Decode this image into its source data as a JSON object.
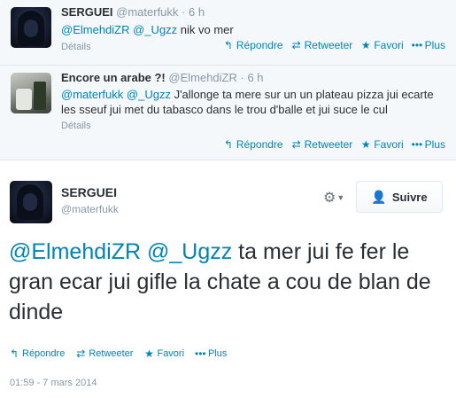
{
  "reply1": {
    "fullname": "SERGUEI",
    "username": "@materfukk",
    "dot": "·",
    "time": "6 h",
    "mention1": "@ElmehdiZR",
    "mention2": "@_Ugzz",
    "text": " nik vo mer",
    "details": "Détails"
  },
  "reply2": {
    "fullname": "Encore un arabe ?!",
    "username": "@ElmehdiZR",
    "dot": "·",
    "time": "6 h",
    "mention1": "@materfukk",
    "mention2": "@_Ugzz",
    "text": " J'allonge ta mere sur un un plateau pizza jui ecarte les sseuf jui met du tabasco dans le trou d'balle et jui suce le cul",
    "details": "Détails"
  },
  "actions": {
    "reply": "Répondre",
    "retweet": "Retweeter",
    "favorite": "Favori",
    "more": "Plus"
  },
  "icons": {
    "reply": "reply-icon",
    "retweet": "retweet-icon",
    "favorite": "star-icon",
    "more": "more-dots-icon",
    "gear": "gear-icon",
    "follow": "add-user-icon"
  },
  "main": {
    "fullname": "SERGUEI",
    "username": "@materfukk",
    "follow_label": "Suivre",
    "mention1": "@ElmehdiZR",
    "mention2": "@_Ugzz",
    "text": " ta mer jui fe fer le gran ecar jui gifle la chate a cou de blan de dinde",
    "timestamp": "01:59 - 7 mars 2014"
  },
  "colors": {
    "link": "#0084b4",
    "muted": "#8899a6",
    "text": "#292f33",
    "reply_bg": "#f5f8fa"
  }
}
